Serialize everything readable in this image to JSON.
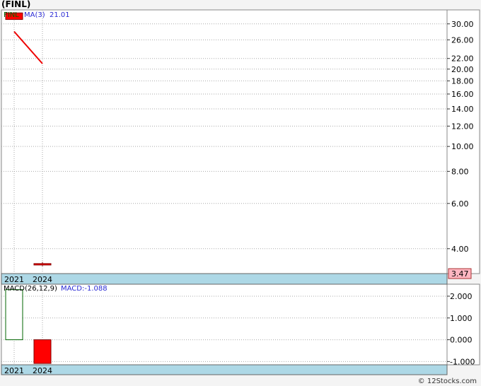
{
  "chart_data": [
    {
      "type": "candlestick",
      "title": "(FINL)",
      "scale": "log",
      "ylim": [
        3.2,
        34
      ],
      "yticks": [
        30,
        26,
        22,
        20,
        18,
        16,
        14,
        12,
        10,
        8,
        6,
        4
      ],
      "ytick_labels": [
        "30.00",
        "26.00",
        "22.00",
        "20.00",
        "18.00",
        "16.00",
        "14.00",
        "12.00",
        "10.00",
        "8.00",
        "6.00",
        "4.00"
      ],
      "categories": [
        "2021",
        "2024"
      ],
      "candles": [
        {
          "x": "2021",
          "open": 33.1,
          "close": 31.2,
          "high": 33.1,
          "low": 31.2
        },
        {
          "x": "2024",
          "open": 3.5,
          "close": 3.47,
          "high": 3.55,
          "low": 3.42
        }
      ],
      "ma": {
        "label": "MA(3)",
        "value_label": "21.01",
        "points": [
          {
            "x": "2021",
            "y": 28.0
          },
          {
            "x": "2024",
            "y": 21.01
          }
        ]
      },
      "legend_symbol": "FINL",
      "last_price_label": "3.47",
      "grid": true
    },
    {
      "type": "bar",
      "title": "MACD(26,12,9)",
      "value_label": "MACD:-1.088",
      "categories": [
        "2021",
        "2024"
      ],
      "values": [
        2.3,
        -1.088
      ],
      "ylim": [
        -1.15,
        2.55
      ],
      "yticks": [
        2.0,
        1.0,
        0.0,
        -1.0
      ],
      "ytick_labels": [
        "2.000",
        "1.000",
        "0.000",
        "-1.000"
      ],
      "grid": true
    }
  ],
  "watermark": "© 12Stocks.com",
  "colors": {
    "up": "#ffffff",
    "down": "#ff0000",
    "up_border": "#006400",
    "ma_line": "#ee0000",
    "band": "#add8e6",
    "price_box": "#ffb6c1",
    "ma_text": "#2a2ad4",
    "symbol_text": "#006400"
  }
}
